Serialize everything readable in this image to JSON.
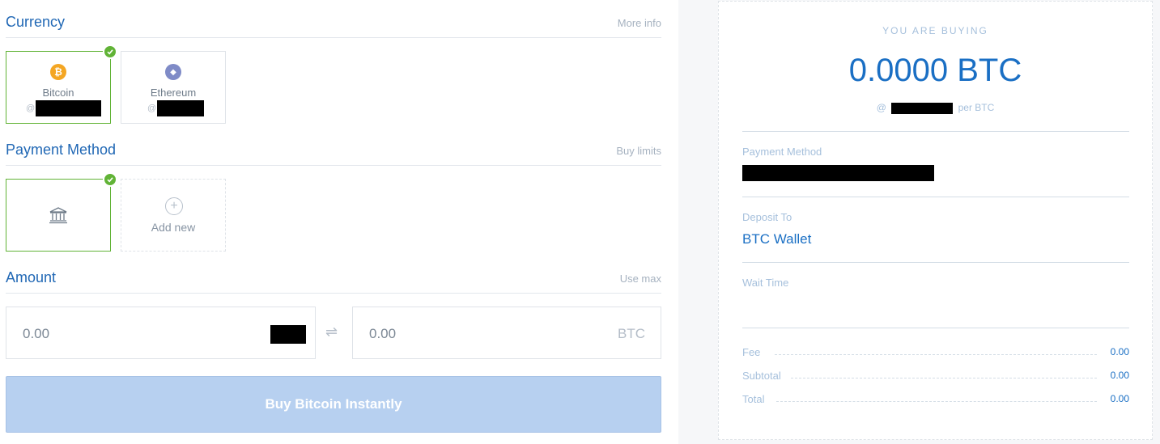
{
  "currency": {
    "title": "Currency",
    "link": "More info",
    "options": [
      {
        "name": "Bitcoin",
        "symbol": "₿",
        "prefix": "@",
        "color": "#f4a623",
        "selected": true
      },
      {
        "name": "Ethereum",
        "symbol": "◆",
        "prefix": "@",
        "color": "#7f8bc7",
        "selected": false
      }
    ]
  },
  "payment": {
    "title": "Payment Method",
    "link": "Buy limits",
    "add_new": "Add new",
    "add_symbol": "+",
    "selected_icon": "bank-icon"
  },
  "amount": {
    "title": "Amount",
    "link": "Use max",
    "fiat_value": "0.00",
    "crypto_value": "0.00",
    "crypto_unit": "BTC",
    "swap_symbol": "⇌"
  },
  "buy_button": "Buy Bitcoin Instantly",
  "summary": {
    "label": "YOU ARE BUYING",
    "amount": "0.0000 BTC",
    "rate_prefix": "@",
    "rate_suffix": "per BTC",
    "payment_label": "Payment Method",
    "deposit_label": "Deposit To",
    "deposit_value": "BTC Wallet",
    "wait_label": "Wait Time",
    "rows": [
      {
        "label": "Fee",
        "value": "0.00"
      },
      {
        "label": "Subtotal",
        "value": "0.00"
      },
      {
        "label": "Total",
        "value": "0.00"
      }
    ]
  },
  "colors": {
    "accent": "#2168b5",
    "selected": "#61b336",
    "button_disabled": "#b7d0f0"
  }
}
